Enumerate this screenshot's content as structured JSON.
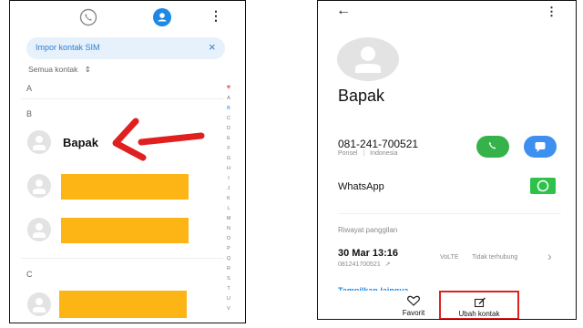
{
  "left_screen": {
    "tabs": [
      {
        "icon": "phone-icon",
        "active": false
      },
      {
        "icon": "contact-icon",
        "active": true
      }
    ],
    "banner": {
      "text": "Impor kontak SIM",
      "close": "×"
    },
    "filter": {
      "label": "Semua kontak",
      "toggle": "⇕"
    },
    "section_a": "A",
    "section_b": "B",
    "section_c": "C",
    "contacts": [
      {
        "name": "Bapak",
        "redacted": false
      },
      {
        "name": "",
        "redacted": true
      },
      {
        "name": "",
        "redacted": true
      },
      {
        "name": "",
        "redacted": true
      }
    ],
    "index": {
      "top": "♥",
      "letters": [
        "A",
        "B",
        "C",
        "D",
        "E",
        "F",
        "G",
        "H",
        "I",
        "J",
        "K",
        "L",
        "M",
        "N",
        "O",
        "P",
        "Q",
        "R",
        "S",
        "T",
        "U",
        "V"
      ]
    },
    "arrow_color": "#e02020"
  },
  "right_screen": {
    "back": "←",
    "menu": "⋮",
    "contact_name": "Bapak",
    "phone_number": "081-241-700521",
    "phone_label": "Ponsel",
    "phone_separator": "|",
    "phone_region": "Indonesia",
    "whatsapp_label": "WhatsApp",
    "history_title": "Riwayat panggilan",
    "history_date": "30 Mar 13:16",
    "history_number": "081241700521",
    "history_arrow": "↗",
    "history_tag": "VoLTE",
    "history_status": "Tidak terhubung",
    "history_chevron": "›",
    "more_link": "Tampilkan lainnya",
    "bottom": {
      "favorite": "Favorit",
      "edit": "Ubah kontak"
    },
    "colors": {
      "call": "#35b34a",
      "message": "#3d8ff0",
      "whatsapp": "#2ec24a",
      "highlight": "#e02020",
      "accent": "#1e88e5"
    }
  }
}
